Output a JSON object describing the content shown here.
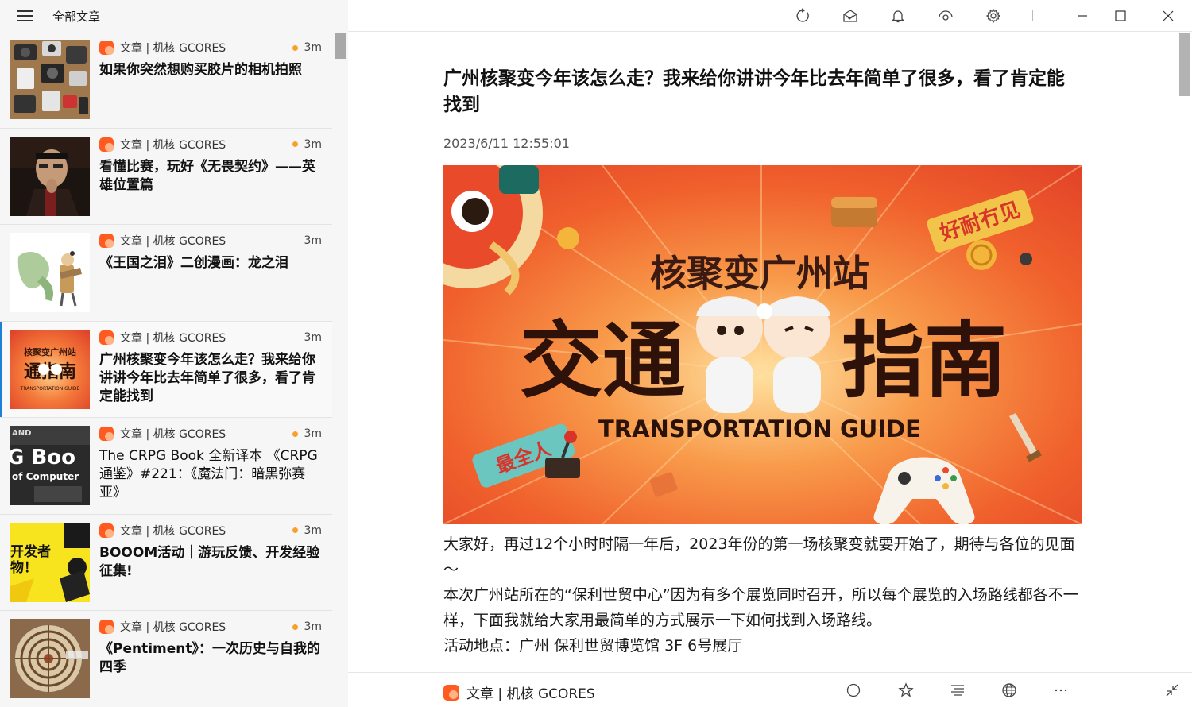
{
  "list_header": {
    "title": "全部文章"
  },
  "articles": [
    {
      "source": "文章 | 机核 GCORES",
      "age": "3m",
      "unread": true,
      "title": "如果你突然想购买胶片的相机拍照"
    },
    {
      "source": "文章 | 机核 GCORES",
      "age": "3m",
      "unread": true,
      "title": "看懂比赛，玩好《无畏契约》——英雄位置篇"
    },
    {
      "source": "文章 | 机核 GCORES",
      "age": "3m",
      "unread": false,
      "title": "《王国之泪》二创漫画：龙之泪"
    },
    {
      "source": "文章 | 机核 GCORES",
      "age": "3m",
      "unread": false,
      "title": "广州核聚变今年该怎么走？我来给你讲讲今年比去年简单了很多，看了肯定能找到",
      "selected": true
    },
    {
      "source": "文章 | 机核 GCORES",
      "age": "3m",
      "unread": true,
      "title": "The CRPG Book 全新译本 《CRPG 通鉴》#221：《魔法门：暗黑弥赛亚》"
    },
    {
      "source": "文章 | 机核 GCORES",
      "age": "3m",
      "unread": true,
      "title": "BOOOM活动｜游玩反馈、开发经验征集!"
    },
    {
      "source": "文章 | 机核 GCORES",
      "age": "3m",
      "unread": true,
      "title": "《Pentiment》：一次历史与自我的四季"
    }
  ],
  "thumb_text": {
    "t4_line1": "核聚变广州站",
    "t4_line2": "通指南",
    "t4_line3": "TRANSPORTATION GUIDE",
    "t5_line1": "AND",
    "t5_line2": "G Boo",
    "t5_line3": "of Computer",
    "t6_line1": "开发者",
    "t6_line2": "物！"
  },
  "article": {
    "title": "广州核聚变今年该怎么走？我来给你讲讲今年比去年简单了很多，看了肯定能找到",
    "date": "2023/6/11 12:55:01",
    "hero": {
      "top": "核聚变广州站",
      "main_left": "交通",
      "main_right": "指南",
      "sub": "TRANSPORTATION GUIDE",
      "tag_right": "好耐冇见",
      "tag_left": "最全人"
    },
    "paragraphs": [
      "大家好，再过12个小时时隔一年后，2023年份的第一场核聚变就要开始了，期待与各位的见面～",
      "本次广州站所在的“保利世贸中心”因为有多个展览同时召开，所以每个展览的入场路线都各不一样，下面我就给大家用最简单的方式展示一下如何找到入场路线。",
      "活动地点：广州 保利世贸博览馆 3F 6号展厅"
    ]
  },
  "bottom_bar": {
    "source": "文章 | 机核 GCORES"
  },
  "icons": {
    "toolbar": [
      "refresh-icon",
      "mark-all-read-icon",
      "bell-icon",
      "view-icon",
      "gear-icon",
      "minimize-icon",
      "maximize-icon",
      "close-icon"
    ],
    "bottom": [
      "circle-icon",
      "star-icon",
      "text-format-icon",
      "globe-icon",
      "more-icon",
      "collapse-icon"
    ]
  },
  "colors": {
    "accent": "#1e7fd8",
    "unread_dot": "#f7a12a",
    "source_icon": "#ff5a1f",
    "hero_bg": "#f05a2a"
  }
}
